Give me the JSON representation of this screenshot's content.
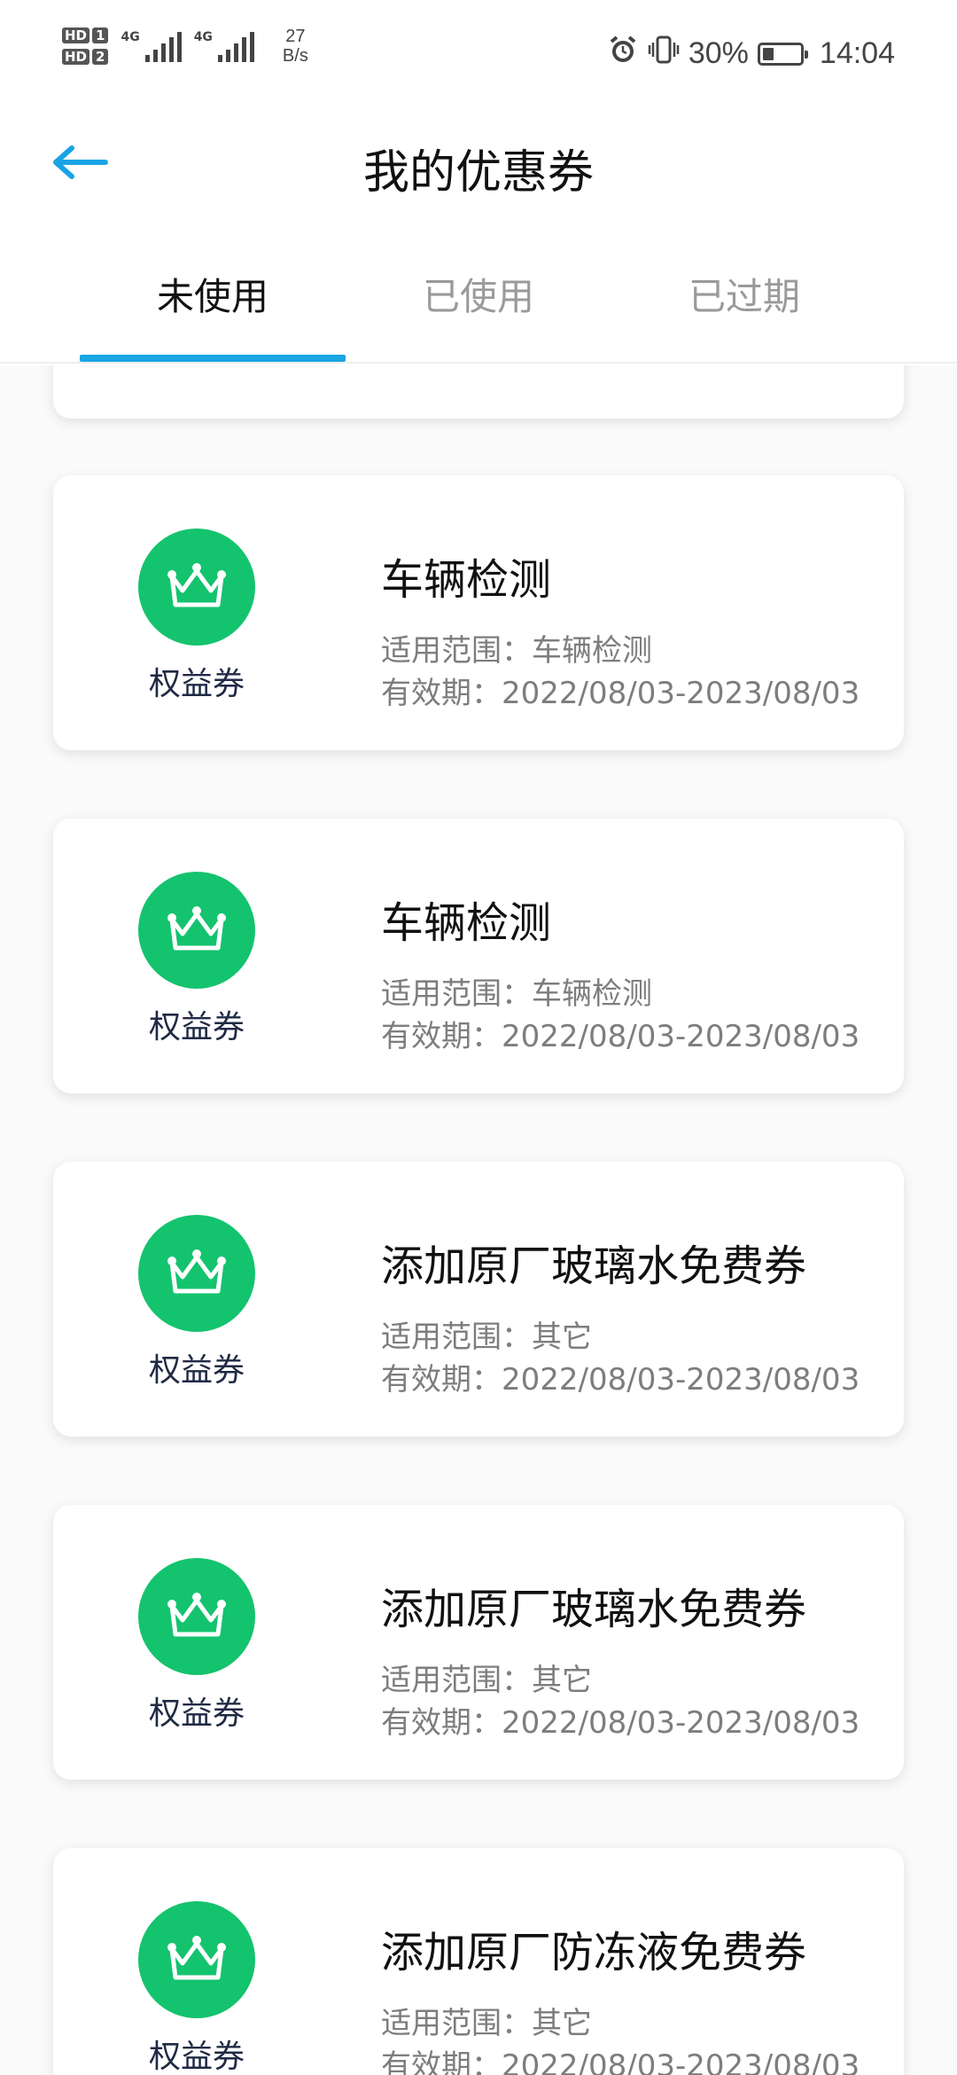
{
  "status_bar": {
    "hd1": "HD",
    "hd1_num": "1",
    "hd2": "HD",
    "hd2_num": "2",
    "net1": "4G",
    "net2": "4G",
    "speed_value": "27",
    "speed_unit": "B/s",
    "battery_percent": "30%",
    "battery_level": 0.3,
    "time": "14:04",
    "icons": [
      "alarm-icon",
      "vibrate-icon",
      "battery-icon"
    ]
  },
  "header": {
    "title": "我的优惠券",
    "back_icon": "arrow-left-icon"
  },
  "tabs": [
    {
      "label": "未使用",
      "active": true
    },
    {
      "label": "已使用",
      "active": false
    },
    {
      "label": "已过期",
      "active": false
    }
  ],
  "colors": {
    "accent": "#19a4e4",
    "icon_bg": "#14c36e"
  },
  "coupons": [
    {
      "badge": "权益券",
      "icon": "crown-icon",
      "title": "车辆检测",
      "scope": "适用范围：车辆检测",
      "validity": "有效期：2022/08/03-2023/08/03"
    },
    {
      "badge": "权益券",
      "icon": "crown-icon",
      "title": "车辆检测",
      "scope": "适用范围：车辆检测",
      "validity": "有效期：2022/08/03-2023/08/03"
    },
    {
      "badge": "权益券",
      "icon": "crown-icon",
      "title": "添加原厂玻璃水免费券",
      "scope": "适用范围：其它",
      "validity": "有效期：2022/08/03-2023/08/03"
    },
    {
      "badge": "权益券",
      "icon": "crown-icon",
      "title": "添加原厂玻璃水免费券",
      "scope": "适用范围：其它",
      "validity": "有效期：2022/08/03-2023/08/03"
    },
    {
      "badge": "权益券",
      "icon": "crown-icon",
      "title": "添加原厂防冻液免费券",
      "scope": "适用范围：其它",
      "validity": "有效期：2022/08/03-2023/08/03"
    }
  ]
}
